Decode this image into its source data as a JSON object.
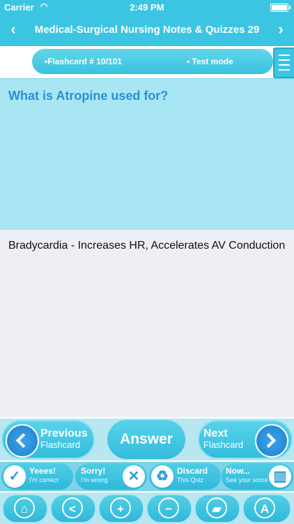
{
  "status": {
    "carrier": "Carrier",
    "time": "2:49 PM"
  },
  "nav": {
    "title": "Medical-Surgical Nursing Notes & Quizzes 29",
    "prev_icon": "chevron-left-icon",
    "next_icon": "chevron-right-icon"
  },
  "info": {
    "flashcard_label": "•Flashcard #  10/101",
    "mode_label": "• Test mode"
  },
  "card": {
    "question": "What is Atropine used for?",
    "answer": "Bradycardia - Increases HR, Accelerates AV Conduction"
  },
  "controls": {
    "previous": {
      "line1": "Previous",
      "line2": "Flashcard"
    },
    "answer_label": "Answer",
    "next": {
      "line1": "Next",
      "line2": "Flashcard"
    }
  },
  "marks": [
    {
      "title": "Yeees!",
      "subtitle": "I'm correct",
      "icon": "check-icon"
    },
    {
      "title": "Sorry!",
      "subtitle": "I'm wrong",
      "icon": "cross-icon"
    },
    {
      "title": "Discard",
      "subtitle": "This Quiz",
      "icon": "recycle-icon"
    },
    {
      "title": "Now...",
      "subtitle": "See your score",
      "icon": "chart-icon"
    }
  ],
  "tools": [
    {
      "icon": "home-icon",
      "glyph": "⌂"
    },
    {
      "icon": "share-icon",
      "glyph": "<"
    },
    {
      "icon": "zoom-in-icon",
      "glyph": "+"
    },
    {
      "icon": "zoom-out-icon",
      "glyph": "−"
    },
    {
      "icon": "paint-bucket-icon",
      "glyph": "▰"
    },
    {
      "icon": "font-icon",
      "glyph": "A"
    }
  ],
  "colors": {
    "accent": "#3cc5e2",
    "question_bg": "#a9e6f4",
    "question_text": "#2a8fd8",
    "answer_bg": "#eeeef5"
  }
}
